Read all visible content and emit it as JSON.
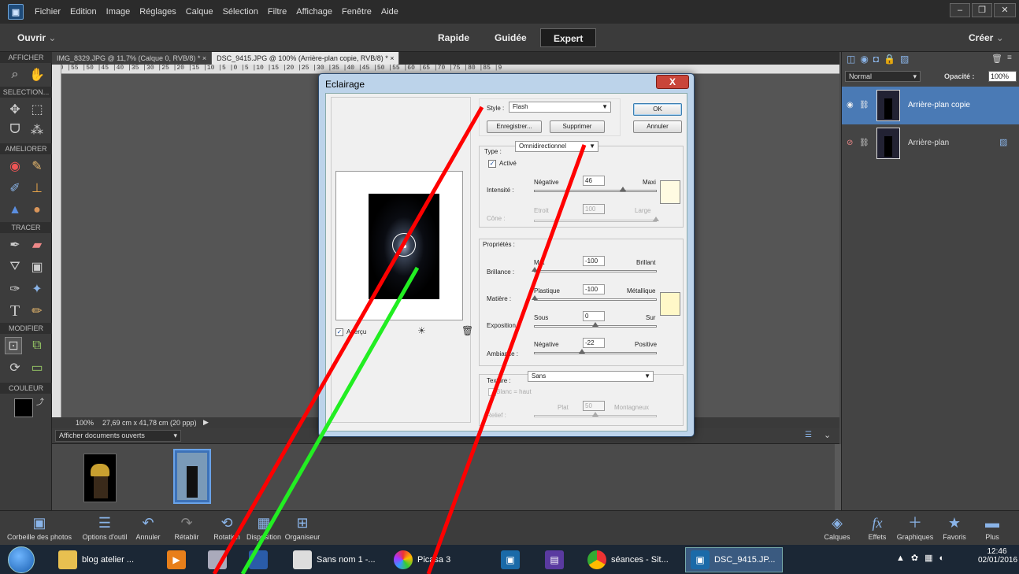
{
  "menu": [
    "Fichier",
    "Edition",
    "Image",
    "Réglages",
    "Calque",
    "Sélection",
    "Filtre",
    "Affichage",
    "Fenêtre",
    "Aide"
  ],
  "modebar": {
    "open_label": "Ouvrir",
    "create_label": "Créer",
    "modes": [
      "Rapide",
      "Guidée",
      "Expert"
    ]
  },
  "toolpanel": {
    "sections": [
      "AFFICHER",
      "SELECTION...",
      "AMELIORER",
      "TRACER",
      "MODIFIER",
      "COULEUR"
    ]
  },
  "doctabs": [
    "IMG_8329.JPG @ 11,7% (Calque 0, RVB/8) * ×",
    "DSC_9415.JPG @ 100% (Arrière-plan copie, RVB/8) * ×"
  ],
  "ruler_text": "|60 |55 |50 |45 |40 |35 |30 |25 |20 |15 |10 |5 |0 |5 |10 |15 |20 |25 |30 |35 |40 |45 |50 |55 |60 |65 |70 |75 |80 |85 |9",
  "status": {
    "zoom": "100%",
    "dims": "27,69 cm x 41,78 cm (20 ppp)"
  },
  "bin": {
    "dropdown": "Afficher documents ouverts"
  },
  "layers": {
    "blend_mode": "Normal",
    "opacity_label": "Opacité :",
    "opacity_value": "100%",
    "items": [
      {
        "name": "Arrière-plan copie",
        "selected": true
      },
      {
        "name": "Arrière-plan",
        "selected": false
      }
    ]
  },
  "dialog": {
    "title": "Eclairage",
    "close": "X",
    "style_label": "Style :",
    "style_value": "Flash",
    "save_button": "Enregistrer...",
    "delete_button": "Supprimer",
    "ok_button": "OK",
    "cancel_button": "Annuler",
    "type_group": "Type :",
    "type_value": "Omnidirectionnel",
    "active_label": "Activé",
    "intensity_label": "Intensité :",
    "intensity_neg": "Négative",
    "intensity_max": "Maxi",
    "intensity_value": "46",
    "cone_label": "Cône :",
    "cone_min": "Etroit",
    "cone_max": "Large",
    "cone_value": "100",
    "props_group": "Propriétés :",
    "gloss_label": "Brillance :",
    "gloss_min": "Mat",
    "gloss_max": "Brillant",
    "gloss_value": "-100",
    "material_label": "Matière :",
    "material_min": "Plastique",
    "material_max": "Métallique",
    "material_value": "-100",
    "exposure_label": "Exposition :",
    "exposure_min": "Sous",
    "exposure_max": "Sur",
    "exposure_value": "0",
    "ambience_label": "Ambiance :",
    "ambience_min": "Négative",
    "ambience_max": "Positive",
    "ambience_value": "-22",
    "texture_label": "Texture :",
    "texture_value": "Sans",
    "white_high": "Blanc = haut",
    "relief_label": "Relief :",
    "relief_min": "Plat",
    "relief_max": "Montagneux",
    "relief_value": "50",
    "preview_label": "Aperçu",
    "levels": {
      "intensity": 0.73,
      "cone": 1.0,
      "gloss": 0.0,
      "material": 0.0,
      "exposure": 0.5,
      "ambience": 0.39,
      "relief": 0.5
    }
  },
  "bottombar": [
    "Corbeille des photos",
    "Options d'outil",
    "Annuler",
    "Rétablir",
    "Rotation",
    "Disposition",
    "Organiseur",
    "Calques",
    "Effets",
    "Graphiques",
    "Favoris",
    "Plus"
  ],
  "taskbar": {
    "items": [
      "blog atelier ...",
      "Sans nom 1 -...",
      "Picasa 3",
      "séances - Sit...",
      "DSC_9415.JP..."
    ],
    "time": "12:46",
    "date": "02/01/2016"
  },
  "colors": {
    "accent": "#4a7ab5",
    "annotation_red": "#ff0000",
    "annotation_green": "#22ee22"
  }
}
